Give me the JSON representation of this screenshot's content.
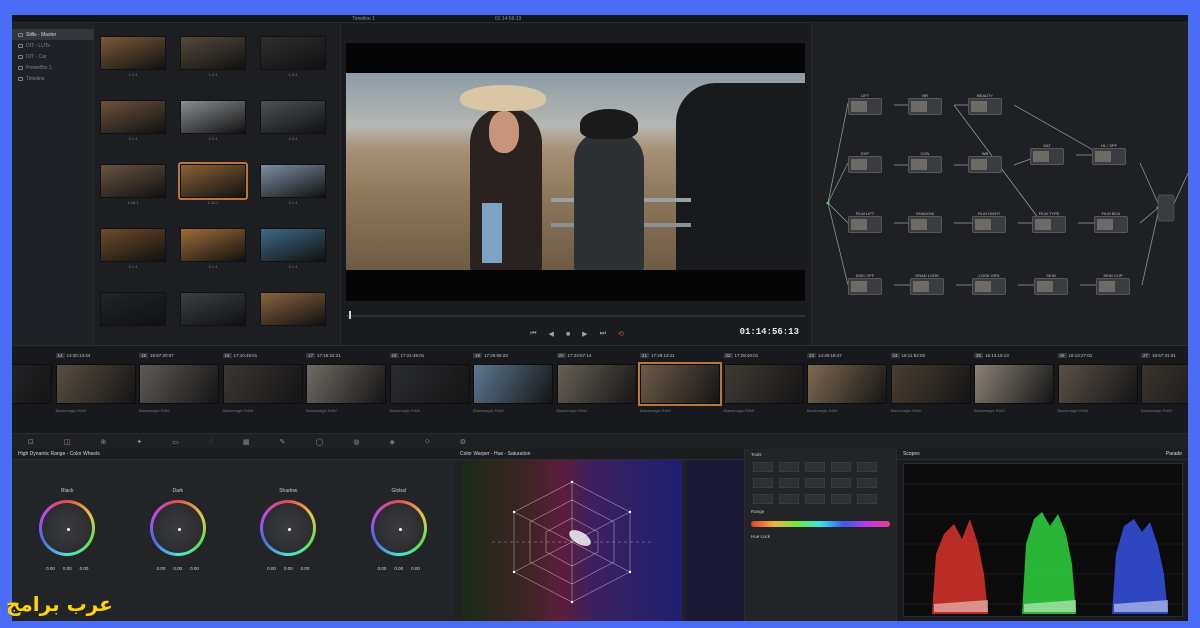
{
  "topbar": {
    "items": [
      "Timeline 1",
      "01:14:56:13"
    ]
  },
  "bins": [
    {
      "label": "Stills - Master",
      "active": true
    },
    {
      "label": "DIT - LUTs",
      "active": false
    },
    {
      "label": "DIT - Car",
      "active": false
    },
    {
      "label": "PowerBin 1",
      "active": false
    },
    {
      "label": "Timeline",
      "active": false
    }
  ],
  "thumbs": [
    {
      "label": "1.1.1",
      "color": "#7a5a3a"
    },
    {
      "label": "1.2.1",
      "color": "#55493c"
    },
    {
      "label": "1.3.1",
      "color": "#2f2f30"
    },
    {
      "label": "2.1.1",
      "color": "#6b533b"
    },
    {
      "label": "2.2.1",
      "color": "#8a8f93"
    },
    {
      "label": "2.3.1",
      "color": "#4b5256"
    },
    {
      "label": "1.18.1",
      "color": "#6a5440"
    },
    {
      "label": "1.11.1",
      "color": "#8a6236",
      "selected": true
    },
    {
      "label": "2.1.1",
      "color": "#7d8fa4"
    },
    {
      "label": "2.1.1",
      "color": "#6e4b2a"
    },
    {
      "label": "2.1.1",
      "color": "#a06c38"
    },
    {
      "label": "2.1.1",
      "color": "#3e6a86"
    },
    {
      "label": "",
      "color": "#1f252c"
    },
    {
      "label": "",
      "color": "#3a4045"
    },
    {
      "label": "",
      "color": "#8a6440"
    }
  ],
  "viewer": {
    "timecode": "01:14:56:13"
  },
  "nodes": [
    {
      "label": "LIFT"
    },
    {
      "label": "NR"
    },
    {
      "label": "BEAUTY"
    },
    {
      "label": "EXP"
    },
    {
      "label": "CON"
    },
    {
      "label": "WB"
    },
    {
      "label": "SAT"
    },
    {
      "label": "HL / SPF"
    },
    {
      "label": "FILM LIFT"
    },
    {
      "label": "SHADOW"
    },
    {
      "label": "FILM HIGHT"
    },
    {
      "label": "FILM TYPE"
    },
    {
      "label": "FILM BOX"
    },
    {
      "label": "DISC OFF"
    },
    {
      "label": "GRAD LOOK"
    },
    {
      "label": "LOOK GEN"
    },
    {
      "label": "SKIN"
    },
    {
      "label": "SKIN CLIP"
    }
  ],
  "clips": [
    {
      "num": "",
      "tc": "13:17",
      "color": "#2a2d31"
    },
    {
      "num": "14",
      "tc": "13:30:13:44",
      "color": "#5a4e42"
    },
    {
      "num": "15",
      "tc": "16:57:20:07",
      "color": "#5e5a55"
    },
    {
      "num": "16",
      "tc": "17:10:45:01",
      "color": "#3a3632"
    },
    {
      "num": "17",
      "tc": "17:15:22:21",
      "color": "#706b64"
    },
    {
      "num": "18",
      "tc": "17:21:45:01",
      "color": "#2a2c30"
    },
    {
      "num": "19",
      "tc": "17:25:55:23",
      "color": "#5d7890"
    },
    {
      "num": "20",
      "tc": "17:23:57:14",
      "color": "#676056"
    },
    {
      "num": "21",
      "tc": "17:29:13:11",
      "color": "#6e5a48",
      "selected": true
    },
    {
      "num": "22",
      "tc": "17:28:40:01",
      "color": "#403a34"
    },
    {
      "num": "23",
      "tc": "14:40:18:47",
      "color": "#7e6a52"
    },
    {
      "num": "24",
      "tc": "16:11:52:03",
      "color": "#4a3e33"
    },
    {
      "num": "25",
      "tc": "16:13:15:13",
      "color": "#8c8278"
    },
    {
      "num": "26",
      "tc": "16:13:27:01",
      "color": "#5a5048"
    },
    {
      "num": "27",
      "tc": "16:57:31:01",
      "color": "#3a332d"
    }
  ],
  "codec": "Blackmagic RAW",
  "tools_icons": [
    "crop-icon",
    "camera-icon",
    "zoom-icon",
    "magic-icon",
    "layers-icon",
    "ellipse-icon",
    "grid-icon",
    "picker-icon",
    "circle-icon",
    "key-icon",
    "blur-icon",
    "keyframe-icon",
    "settings-icon"
  ],
  "wheels_panel": {
    "title": "High Dynamic Range - Color Wheels",
    "wheels": [
      {
        "name": "Black",
        "vals": [
          "0.00",
          "0.00",
          "0.00"
        ]
      },
      {
        "name": "Dark",
        "vals": [
          "0.00",
          "0.00",
          "0.00"
        ]
      },
      {
        "name": "Shadow",
        "vals": [
          "0.00",
          "0.00",
          "0.00"
        ]
      },
      {
        "name": "Global",
        "vals": [
          "0.00",
          "0.00",
          "0.00"
        ]
      }
    ]
  },
  "warper": {
    "title": "Color Warper - Hue - Saturation"
  },
  "palette": {
    "tools": "Tools",
    "range": "Range",
    "hue_lock": "Hue Lock"
  },
  "scopes": {
    "title": "Scopes",
    "mode": "Parade"
  },
  "watermark": "عرب برامج"
}
